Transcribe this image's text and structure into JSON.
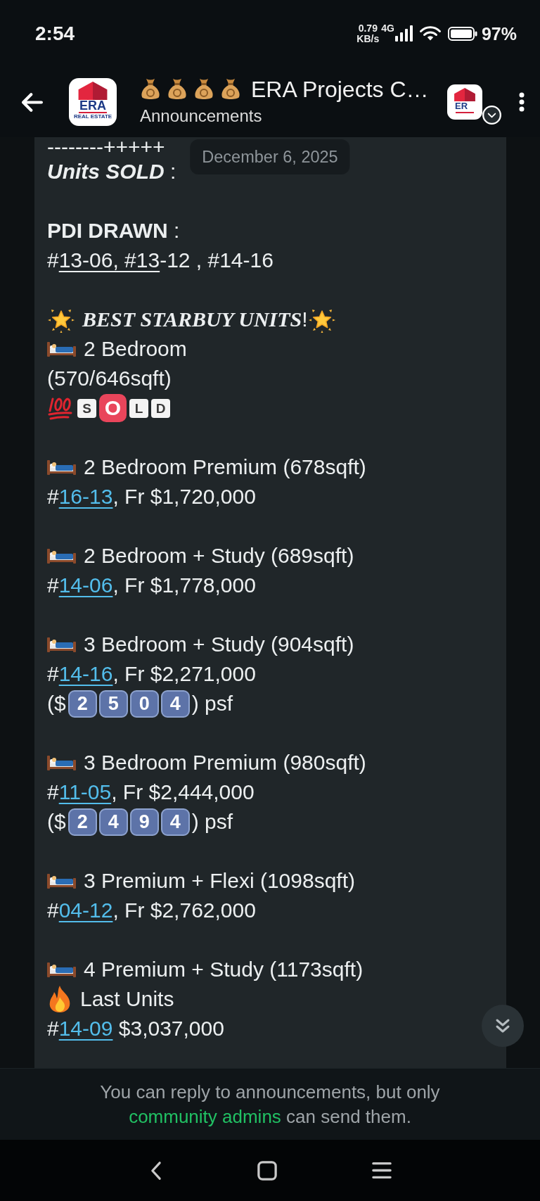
{
  "status_bar": {
    "time": "2:54",
    "speed": "0.79",
    "speed_unit": "KB/s",
    "network": "4G",
    "battery": "97%"
  },
  "header": {
    "logo": {
      "name": "ERA",
      "tagline": "REAL ESTATE"
    },
    "title": "ERA Projects C…",
    "subtitle": "Announcements",
    "community_logo": {
      "name": "ER"
    }
  },
  "date_chip": "December 6, 2025",
  "message": {
    "blocks": [
      [
        {
          "kind": "text",
          "text": "--------+++++"
        },
        {
          "kind": "text",
          "text": "*Units SOLD* :"
        }
      ],
      [
        {
          "kind": "text",
          "text": "**PDI DRAWN** :"
        },
        {
          "kind": "linked",
          "before": "#",
          "link": {
            "text": "13-06, #13",
            "kind": "plain"
          },
          "after": "-12 , #14-16"
        }
      ],
      [
        {
          "kind": "starred",
          "text": "*BEST STARBUY UNITS*!"
        },
        {
          "kind": "bed",
          "text": "2 Bedroom"
        },
        {
          "kind": "text",
          "text": "(570/646sqft)"
        },
        {
          "kind": "sold-tag",
          "letters": [
            {
              "char": "S",
              "color": "#f4f4f4"
            },
            {
              "char": "O",
              "color": "#e9455b"
            },
            {
              "char": "L",
              "color": "#f4f4f4"
            },
            {
              "char": "D",
              "color": "#f4f4f4"
            }
          ]
        }
      ],
      [
        {
          "kind": "bed",
          "text": "2 Bedroom Premium (678sqft)"
        },
        {
          "kind": "linked",
          "before": "#",
          "link": {
            "text": "16-13",
            "kind": "accent"
          },
          "after": ", Fr $1,720,000"
        }
      ],
      [
        {
          "kind": "bed",
          "text": "2 Bedroom + Study (689sqft)"
        },
        {
          "kind": "linked",
          "before": "#",
          "link": {
            "text": "14-06",
            "kind": "accent"
          },
          "after": ", Fr $1,778,000"
        }
      ],
      [
        {
          "kind": "bed",
          "text": "3 Bedroom + Study (904sqft)"
        },
        {
          "kind": "linked",
          "before": "#",
          "link": {
            "text": "14-16",
            "kind": "accent"
          },
          "after": ", Fr $2,271,000"
        },
        {
          "kind": "keycaps",
          "before": "($",
          "digits": [
            "2",
            "5",
            "0",
            "4"
          ],
          "after": ") psf"
        }
      ],
      [
        {
          "kind": "bed",
          "text": "3 Bedroom Premium (980sqft)"
        },
        {
          "kind": "linked",
          "before": "#",
          "link": {
            "text": "11-05",
            "kind": "accent"
          },
          "after": ", Fr $2,444,000"
        },
        {
          "kind": "keycaps",
          "before": "($",
          "digits": [
            "2",
            "4",
            "9",
            "4"
          ],
          "after": ") psf"
        }
      ],
      [
        {
          "kind": "bed",
          "text": "3 Premium + Flexi (1098sqft)"
        },
        {
          "kind": "linked",
          "before": "#",
          "link": {
            "text": "04-12",
            "kind": "accent"
          },
          "after": ", Fr $2,762,000"
        }
      ],
      [
        {
          "kind": "bed",
          "text": "4 Premium + Study (1173sqft)"
        },
        {
          "kind": "fire",
          "text": "Last Units"
        },
        {
          "kind": "linked",
          "before": "#",
          "link": {
            "text": "14-09",
            "kind": "accent"
          },
          "after": " $3,037,000"
        }
      ]
    ]
  },
  "notice": {
    "before": "You can reply to announcements, but only ",
    "link": "community admins",
    "after": " can send them."
  }
}
